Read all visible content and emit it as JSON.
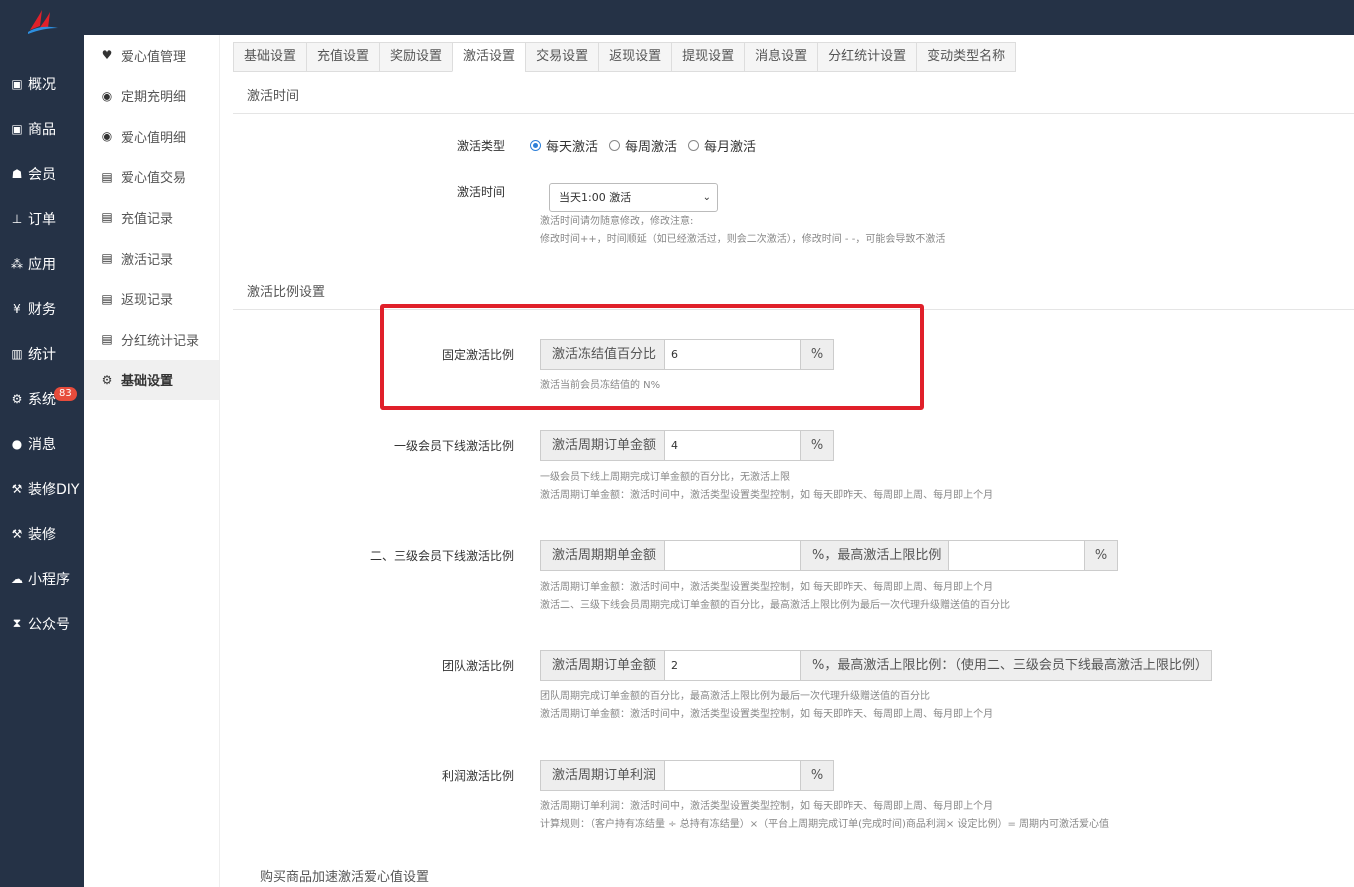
{
  "nav": [
    {
      "icon": "archive-icon",
      "glyph": "▣",
      "label": "概况"
    },
    {
      "icon": "archive-icon",
      "glyph": "▣",
      "label": "商品"
    },
    {
      "icon": "users-icon",
      "glyph": "☗",
      "label": "会员"
    },
    {
      "icon": "cart-icon",
      "glyph": "⊥",
      "label": "订单"
    },
    {
      "icon": "cubes-icon",
      "glyph": "⁂",
      "label": "应用"
    },
    {
      "icon": "yen-icon",
      "glyph": "¥",
      "label": "财务"
    },
    {
      "icon": "bar-chart-icon",
      "glyph": "▥",
      "label": "统计"
    },
    {
      "icon": "gears-icon",
      "glyph": "⚙",
      "label": "系统"
    },
    {
      "icon": "chat-icon",
      "glyph": "●",
      "label": "消息"
    },
    {
      "icon": "gavel-icon",
      "glyph": "⚒",
      "label": "装修DIY"
    },
    {
      "icon": "gavel-icon",
      "glyph": "⚒",
      "label": "装修"
    },
    {
      "icon": "wechat-icon",
      "glyph": "☁",
      "label": "小程序"
    },
    {
      "icon": "hourglass-icon",
      "glyph": "⧗",
      "label": "公众号"
    }
  ],
  "message_badge": "83",
  "subnav": [
    {
      "icon": "heart-icon",
      "glyph": "♥",
      "label": "爱心值管理"
    },
    {
      "icon": "heart-circle-icon",
      "glyph": "◉",
      "label": "定期充明细"
    },
    {
      "icon": "heart-circle-icon",
      "glyph": "◉",
      "label": "爱心值明细"
    },
    {
      "icon": "file-icon",
      "glyph": "▤",
      "label": "爱心值交易"
    },
    {
      "icon": "file-icon",
      "glyph": "▤",
      "label": "充值记录"
    },
    {
      "icon": "file-icon",
      "glyph": "▤",
      "label": "激活记录"
    },
    {
      "icon": "file-icon",
      "glyph": "▤",
      "label": "返现记录"
    },
    {
      "icon": "file-icon",
      "glyph": "▤",
      "label": "分红统计记录"
    },
    {
      "icon": "gears-icon",
      "glyph": "⚙",
      "label": "基础设置"
    }
  ],
  "tabs": [
    "基础设置",
    "充值设置",
    "奖励设置",
    "激活设置",
    "交易设置",
    "返现设置",
    "提现设置",
    "消息设置",
    "分红统计设置",
    "变动类型名称"
  ],
  "active_tab": "激活设置",
  "section_time": "激活时间",
  "activation_type": {
    "label": "激活类型",
    "options": [
      "每天激活",
      "每周激活",
      "每月激活"
    ],
    "selected": "每天激活"
  },
  "activation_time": {
    "label": "激活时间",
    "value": "当天1:00 激活",
    "help1": "激活时间请勿随意修改，修改注意:",
    "help2": "修改时间++，时间顺延（如已经激活过，则会二次激活），修改时间 - -，可能会导致不激活"
  },
  "section_ratio": "激活比例设置",
  "fixed": {
    "label": "固定激活比例",
    "addon": "激活冻结值百分比",
    "value": "6",
    "unit": "%",
    "help": "激活当前会员冻结值的 N%"
  },
  "level1": {
    "label": "一级会员下线激活比例",
    "addon": "激活周期订单金额",
    "value": "4",
    "unit": "%",
    "help1": "一级会员下线上周期完成订单金额的百分比，无激活上限",
    "help2": "激活周期订单金额：激活时间中，激活类型设置类型控制，如 每天即昨天、每周即上周、每月即上个月"
  },
  "level23": {
    "label": "二、三级会员下线激活比例",
    "addon": "激活周期期单金额",
    "value": "",
    "mid": "%，最高激活上限比例",
    "value2": "",
    "unit": "%",
    "help1": "激活周期订单金额：激活时间中，激活类型设置类型控制，如 每天即昨天、每周即上周、每月即上个月",
    "help2": "激活二、三级下线会员周期完成订单金额的百分比，最高激活上限比例为最后一次代理升级赠送值的百分比"
  },
  "team": {
    "label": "团队激活比例",
    "addon": "激活周期订单金额",
    "value": "2",
    "mid": "%，最高激活上限比例：（使用二、三级会员下线最高激活上限比例）",
    "help1": "团队周期完成订单金额的百分比，最高激活上限比例为最后一次代理升级赠送值的百分比",
    "help2": "激活周期订单金额：激活时间中，激活类型设置类型控制，如 每天即昨天、每周即上周、每月即上个月"
  },
  "profit": {
    "label": "利润激活比例",
    "addon": "激活周期订单利润",
    "value": "",
    "unit": "%",
    "help1": "激活周期订单利润：激活时间中，激活类型设置类型控制，如 每天即昨天、每周即上周、每月即上个月",
    "help2": "计算规则：（客户持有冻结量 ÷ 总持有冻结量）×（平台上周期完成订单(完成时间)商品利润× 设定比例）= 周期内可激活爱心值"
  },
  "section_bottom": "购买商品加速激活爱心值设置",
  "colors": {
    "sidebar": "#253246",
    "highlight": "#e0202a",
    "radio": "#2d7fd8"
  }
}
